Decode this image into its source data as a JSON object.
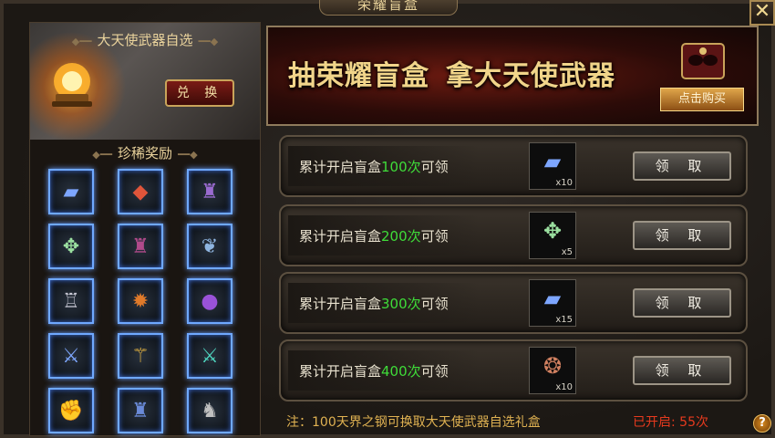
{
  "window": {
    "title": "荣耀盲盒",
    "close_icon": "close-icon"
  },
  "left_panel": {
    "weapon_title": "大天使武器自选",
    "exchange_label": "兑 换",
    "rare_title": "珍稀奖励",
    "rare_items": [
      {
        "icon": "blue-ingot-icon",
        "glyph": "▰",
        "color": "#7da6ff"
      },
      {
        "icon": "red-gem-icon",
        "glyph": "◆",
        "color": "#e0553a"
      },
      {
        "icon": "dark-armor-icon",
        "glyph": "♜",
        "color": "#9a6bd0"
      },
      {
        "icon": "green-amulet-icon",
        "glyph": "✥",
        "color": "#9be0a0"
      },
      {
        "icon": "dark-armor-icon",
        "glyph": "♜",
        "color": "#b04a8a"
      },
      {
        "icon": "feather-icon",
        "glyph": "❦",
        "color": "#8fb5e0"
      },
      {
        "icon": "armor-icon",
        "glyph": "♖",
        "color": "#c8c8d4"
      },
      {
        "icon": "cannon-icon",
        "glyph": "✹",
        "color": "#e07a2a"
      },
      {
        "icon": "purple-orb-icon",
        "glyph": "●",
        "color": "#9a52d8"
      },
      {
        "icon": "sword-icon",
        "glyph": "⚔",
        "color": "#7fa8ff"
      },
      {
        "icon": "staff-icon",
        "glyph": "⚚",
        "color": "#e0b040"
      },
      {
        "icon": "blade-icon",
        "glyph": "⚔",
        "color": "#4fd8c0"
      },
      {
        "icon": "gauntlet-icon",
        "glyph": "✊",
        "color": "#a0a0a0"
      },
      {
        "icon": "chest-armor-icon",
        "glyph": "♜",
        "color": "#6a8ad8"
      },
      {
        "icon": "dark-helm-icon",
        "glyph": "♞",
        "color": "#c0c0c0"
      }
    ]
  },
  "banner": {
    "text_part1": "抽荣耀盲盒",
    "text_part2": "拿大天使武器",
    "buy_label": "点击购买",
    "mask_icon": "mask-icon"
  },
  "rewards": [
    {
      "prefix": "累计开启盲盒",
      "count": "100次",
      "suffix": "可领",
      "item_icon": "blue-ingot-icon",
      "glyph": "▰",
      "color": "#7da6ff",
      "qty": "x10",
      "claim_label": "领 取"
    },
    {
      "prefix": "累计开启盲盒",
      "count": "200次",
      "suffix": "可领",
      "item_icon": "green-amulet-icon",
      "glyph": "✥",
      "color": "#9be0a0",
      "qty": "x5",
      "claim_label": "领 取"
    },
    {
      "prefix": "累计开启盲盒",
      "count": "300次",
      "suffix": "可领",
      "item_icon": "blue-ingot-icon",
      "glyph": "▰",
      "color": "#7da6ff",
      "qty": "x15",
      "claim_label": "领 取"
    },
    {
      "prefix": "累计开启盲盒",
      "count": "400次",
      "suffix": "可领",
      "item_icon": "mask-icon",
      "glyph": "❂",
      "color": "#d08060",
      "qty": "x10",
      "claim_label": "领 取"
    }
  ],
  "footer": {
    "note": "注：100天界之钢可换取大天使武器自选礼盒",
    "opened": "已开启: 55次",
    "help": "?"
  }
}
